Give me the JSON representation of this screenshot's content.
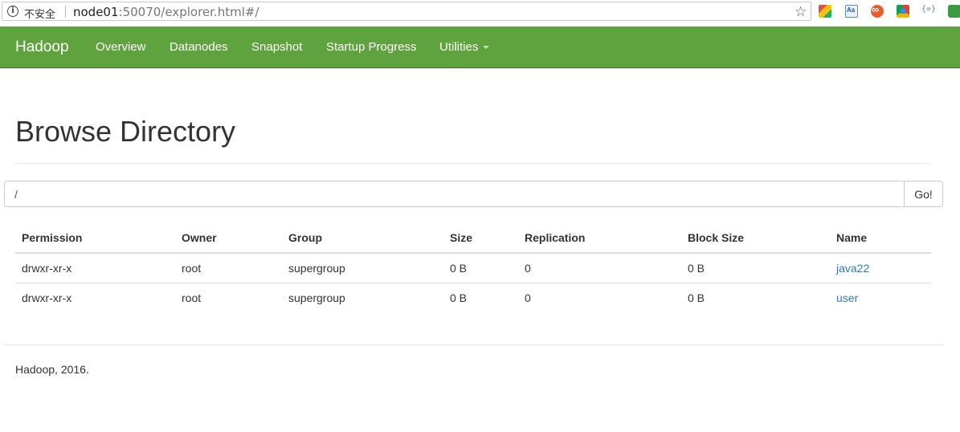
{
  "browser": {
    "security_label": "不安全",
    "url_host": "node01",
    "url_rest": ":50070/explorer.html#/",
    "info_icon": "i"
  },
  "navbar": {
    "brand": "Hadoop",
    "items": [
      {
        "label": "Overview"
      },
      {
        "label": "Datanodes"
      },
      {
        "label": "Snapshot"
      },
      {
        "label": "Startup Progress"
      },
      {
        "label": "Utilities"
      }
    ],
    "color": "#5fa33e"
  },
  "page": {
    "title": "Browse Directory"
  },
  "path": {
    "value": "/",
    "go_label": "Go!"
  },
  "table": {
    "headers": [
      "Permission",
      "Owner",
      "Group",
      "Size",
      "Replication",
      "Block Size",
      "Name"
    ],
    "rows": [
      {
        "permission": "drwxr-xr-x",
        "owner": "root",
        "group": "supergroup",
        "size": "0 B",
        "replication": "0",
        "block_size": "0 B",
        "name": "java22"
      },
      {
        "permission": "drwxr-xr-x",
        "owner": "root",
        "group": "supergroup",
        "size": "0 B",
        "replication": "0",
        "block_size": "0 B",
        "name": "user"
      }
    ],
    "link_color": "#337ab7"
  },
  "footer": {
    "text": "Hadoop, 2016."
  }
}
